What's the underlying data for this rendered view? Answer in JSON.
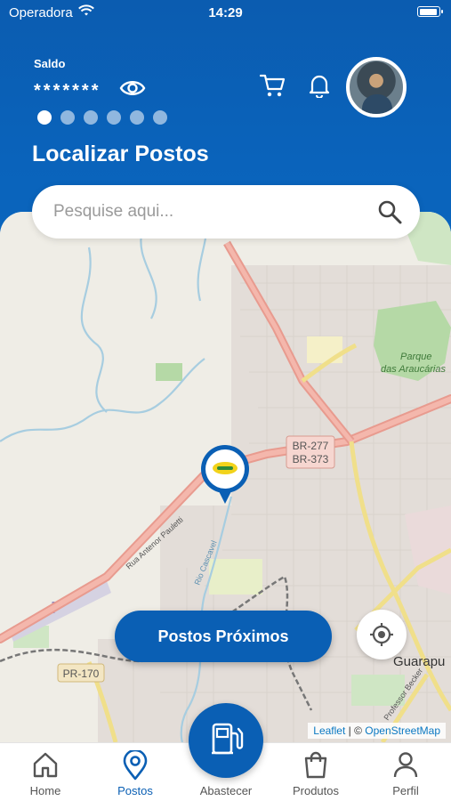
{
  "status_bar": {
    "carrier": "Operadora",
    "time": "14:29"
  },
  "wallet": {
    "label": "Saldo",
    "value": "*******",
    "carousel_pages": 6,
    "active_page": 1
  },
  "header": {
    "title": "Localizar Postos"
  },
  "search": {
    "placeholder": "Pesquise aqui..."
  },
  "map": {
    "road_labels": [
      "BR-277",
      "BR-373",
      "PR-170"
    ],
    "street_labels": [
      "Rua Antenor Pauletti",
      "Rio Cascavel",
      "Professor Becker"
    ],
    "place_labels": [
      "Parque",
      "das Araucárias",
      "Guarapu"
    ],
    "attribution": {
      "leaflet": "Leaflet",
      "separator": " | © ",
      "osm": "OpenStreetMap"
    }
  },
  "actions": {
    "nearby_label": "Postos Próximos"
  },
  "tabs": [
    {
      "label": "Home",
      "icon": "home-icon"
    },
    {
      "label": "Postos",
      "icon": "map-pin-icon",
      "active": true
    },
    {
      "label": "Abastecer",
      "icon": "fuel-pump-icon"
    },
    {
      "label": "Produtos",
      "icon": "shopping-bag-icon"
    },
    {
      "label": "Perfil",
      "icon": "user-icon"
    }
  ],
  "colors": {
    "primary": "#0a5fb4",
    "map_background": "#efede6",
    "highway": "#e89b8f",
    "park": "#b5d9a6"
  }
}
